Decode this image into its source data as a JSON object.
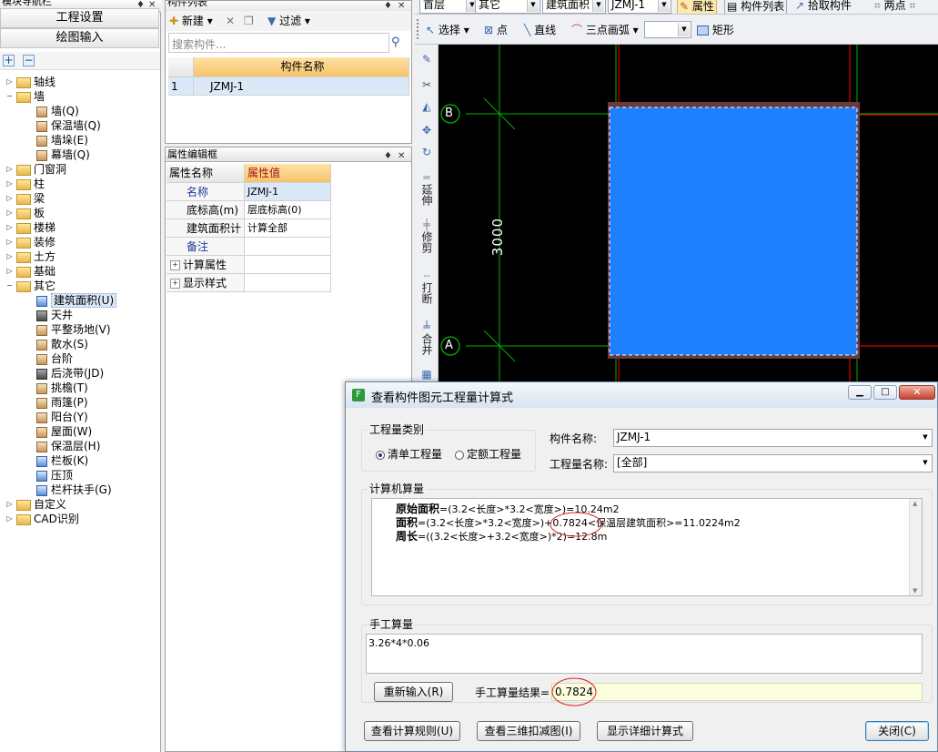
{
  "nav_panel": {
    "title": "模块导航栏",
    "btn_project": "工程设置",
    "btn_draw": "绘图输入",
    "tree": [
      {
        "label": "轴线",
        "level": 0,
        "expanded": false
      },
      {
        "label": "墙",
        "level": 0,
        "expanded": true
      },
      {
        "label": "墙(Q)",
        "level": 1
      },
      {
        "label": "保温墙(Q)",
        "level": 1
      },
      {
        "label": "墙垛(E)",
        "level": 1
      },
      {
        "label": "幕墙(Q)",
        "level": 1
      },
      {
        "label": "门窗洞",
        "level": 0,
        "expanded": false
      },
      {
        "label": "柱",
        "level": 0,
        "expanded": false
      },
      {
        "label": "梁",
        "level": 0,
        "expanded": false
      },
      {
        "label": "板",
        "level": 0,
        "expanded": false
      },
      {
        "label": "楼梯",
        "level": 0,
        "expanded": false
      },
      {
        "label": "装修",
        "level": 0,
        "expanded": false
      },
      {
        "label": "土方",
        "level": 0,
        "expanded": false
      },
      {
        "label": "基础",
        "level": 0,
        "expanded": false
      },
      {
        "label": "其它",
        "level": 0,
        "expanded": true
      },
      {
        "label": "建筑面积(U)",
        "level": 1,
        "selected": true
      },
      {
        "label": "天井",
        "level": 1
      },
      {
        "label": "平整场地(V)",
        "level": 1
      },
      {
        "label": "散水(S)",
        "level": 1
      },
      {
        "label": "台阶",
        "level": 1
      },
      {
        "label": "后浇带(JD)",
        "level": 1
      },
      {
        "label": "挑檐(T)",
        "level": 1
      },
      {
        "label": "雨篷(P)",
        "level": 1
      },
      {
        "label": "阳台(Y)",
        "level": 1
      },
      {
        "label": "屋面(W)",
        "level": 1
      },
      {
        "label": "保温层(H)",
        "level": 1
      },
      {
        "label": "栏板(K)",
        "level": 1
      },
      {
        "label": "压顶",
        "level": 1
      },
      {
        "label": "栏杆扶手(G)",
        "level": 1
      },
      {
        "label": "自定义",
        "level": 0,
        "expanded": false
      },
      {
        "label": "CAD识别",
        "level": 0,
        "expanded": false
      }
    ]
  },
  "component_panel": {
    "title": "构件列表",
    "new_label": "新建",
    "filter_label": "过滤",
    "search_placeholder": "搜索构件...",
    "col_header": "构件名称",
    "rows": [
      {
        "index": "1",
        "name": "JZMJ-1"
      }
    ]
  },
  "attr_panel": {
    "title": "属性编辑框",
    "col_name": "属性名称",
    "col_value": "属性值",
    "rows": [
      {
        "name": "名称",
        "value": "JZMJ-1",
        "link": true
      },
      {
        "name": "底标高(m)",
        "value": "层底标高(0)",
        "link": false
      },
      {
        "name": "建筑面积计",
        "value": "计算全部",
        "link": false
      },
      {
        "name": "备注",
        "value": "",
        "link": true
      },
      {
        "name": "计算属性",
        "value": "",
        "expand": true
      },
      {
        "name": "显示样式",
        "value": "",
        "expand": true
      }
    ]
  },
  "top_toolbar": {
    "floor": "首层",
    "category": "其它",
    "type": "建筑面积",
    "component": "JZMJ-1",
    "attr_btn": "属性",
    "list_btn": "构件列表",
    "pick_btn": "拾取构件",
    "two_points": "两点"
  },
  "draw_toolbar": {
    "select": "选择",
    "point": "点",
    "line": "直线",
    "arc": "三点画弧",
    "rect": "矩形"
  },
  "vertical_tools": [
    "延伸",
    "修剪",
    "打断",
    "合并"
  ],
  "canvas": {
    "axis_b": "B",
    "axis_a": "A",
    "dimension": "3000",
    "colors": {
      "background": "#000000",
      "fill": "#1e7fff",
      "grid": "#00b000",
      "red": "#ff0000"
    }
  },
  "dialog": {
    "title": "查看构件图元工程量计算式",
    "qty_type_legend": "工程量类别",
    "radio_list": "清单工程量",
    "radio_quota": "定额工程量",
    "comp_name_label": "构件名称:",
    "comp_name_value": "JZMJ-1",
    "qty_name_label": "工程量名称:",
    "qty_name_value": "[全部]",
    "computed_legend": "计算机算量",
    "formulas": [
      {
        "label": "原始面积",
        "expr": "=(3.2<长度>*3.2<宽度>)=10.24m2"
      },
      {
        "label": "面积",
        "expr": "=(3.2<长度>*3.2<宽度>)+0.7824<保温层建筑面积>=11.0224m2"
      },
      {
        "label": "周长",
        "expr": "=((3.2<长度>+3.2<宽度>)*2)=12.8m"
      }
    ],
    "manual_legend": "手工算量",
    "manual_input": "3.26*4*0.06",
    "reenter_btn": "重新输入(R)",
    "result_label": "手工算量结果=",
    "result_value": "0.7824",
    "btn_rules": "查看计算规则(U)",
    "btn_3d": "查看三维扣减图(I)",
    "btn_detail": "显示详细计算式",
    "btn_close": "关闭(C)"
  }
}
